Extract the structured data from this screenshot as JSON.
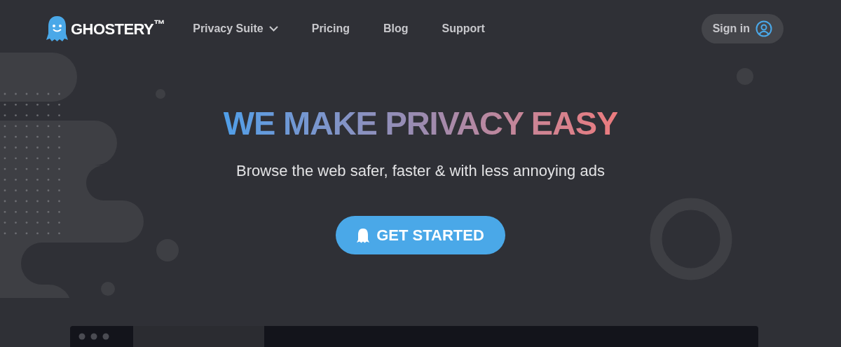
{
  "header": {
    "brand": "GHOSTERY$^{™}$",
    "nav": [
      {
        "label": "Privacy Suite",
        "kind": "dropdown"
      },
      {
        "label": "Pricing",
        "kind": "link"
      },
      {
        "label": "Blog",
        "kind": "link"
      },
      {
        "label": "Support",
        "kind": "link"
      }
    ],
    "sign_in": "Sign in"
  },
  "hero": {
    "title": "WE MAKE PRIVACY EASY",
    "subtitle": "Browse the web safer, faster & with less annoying ads",
    "cta": "GET STARTED"
  }
}
